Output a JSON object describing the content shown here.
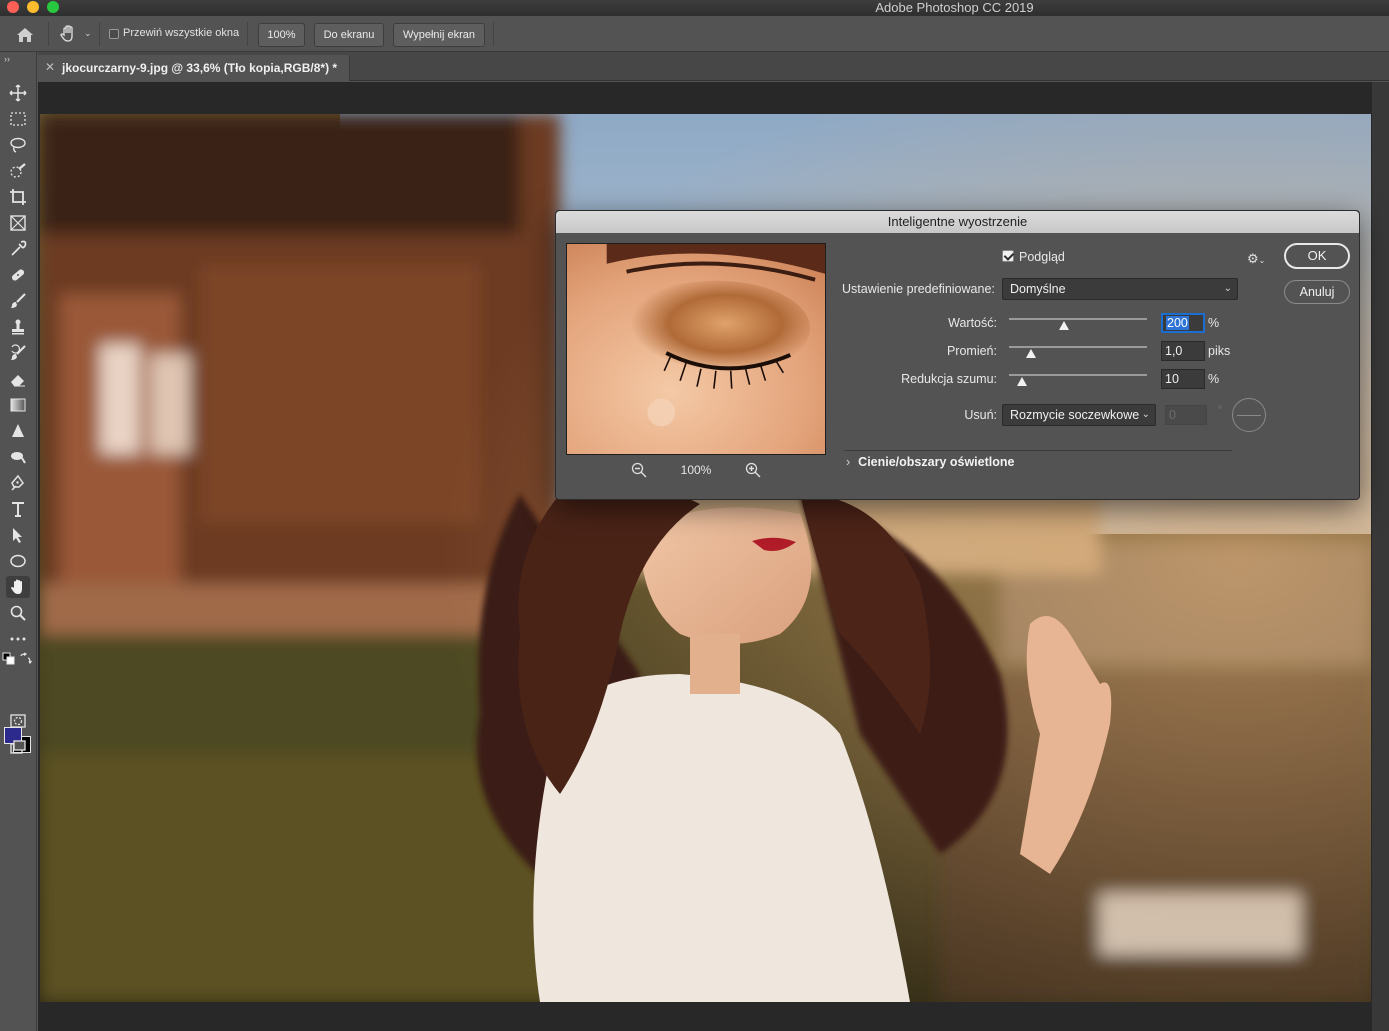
{
  "window": {
    "title": "Adobe Photoshop CC 2019"
  },
  "options_bar": {
    "scroll_all_label": "Przewiń wszystkie okna",
    "zoom_100_label": "100%",
    "fit_screen_label": "Do ekranu",
    "fill_screen_label": "Wypełnij ekran"
  },
  "document": {
    "tab_title": "jkocurczarny-9.jpg @ 33,6% (Tło kopia,RGB/8*) *"
  },
  "toolbar": {
    "tools": [
      "move-tool",
      "marquee-tool",
      "lasso-tool",
      "quick-selection-tool",
      "crop-tool",
      "frame-tool",
      "eyedropper-tool",
      "healing-brush-tool",
      "brush-tool",
      "clone-stamp-tool",
      "history-brush-tool",
      "eraser-tool",
      "gradient-tool",
      "blur-tool",
      "dodge-tool",
      "pen-tool",
      "type-tool",
      "path-selection-tool",
      "ellipse-tool",
      "hand-tool",
      "zoom-tool",
      "more-tools"
    ],
    "active_tool": "hand-tool",
    "foreground_color": "#2c2a8c",
    "background_color": "#000000"
  },
  "dialog": {
    "title": "Inteligentne wyostrzenie",
    "preview_label": "Podgląd",
    "preview_checked": true,
    "preview_zoom": "100%",
    "ok_label": "OK",
    "cancel_label": "Anuluj",
    "preset_label": "Ustawienie predefiniowane:",
    "preset_value": "Domyślne",
    "amount": {
      "label": "Wartość:",
      "value": "200",
      "unit": "%"
    },
    "radius": {
      "label": "Promień:",
      "value": "1,0",
      "unit": "piks"
    },
    "noise": {
      "label": "Redukcja szumu:",
      "value": "10",
      "unit": "%"
    },
    "remove": {
      "label": "Usuń:",
      "value": "Rozmycie soczewkowe",
      "angle": "0",
      "angle_unit": "°"
    },
    "section_label": "Cienie/obszary oświetlone"
  }
}
